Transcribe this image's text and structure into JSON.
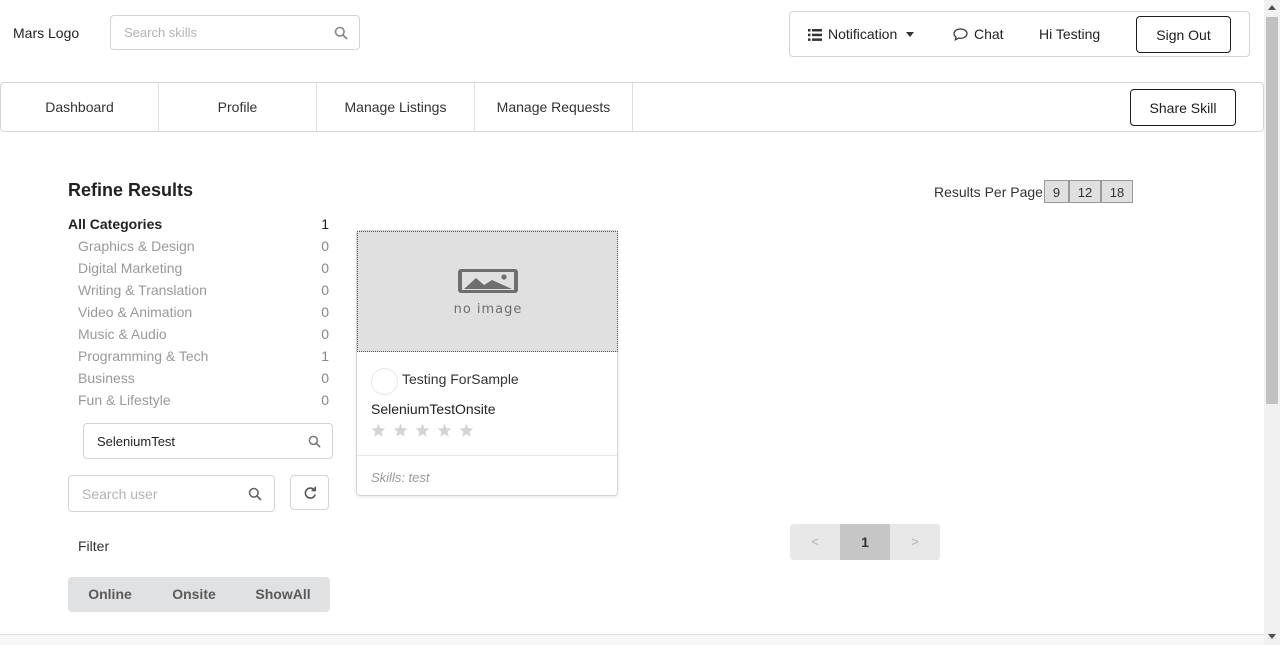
{
  "header": {
    "logo": "Mars Logo",
    "search": {
      "placeholder": "Search skills",
      "value": ""
    },
    "notification_label": "Notification",
    "chat_label": "Chat",
    "greeting": "Hi Testing",
    "signout_label": "Sign Out"
  },
  "nav": {
    "items": [
      {
        "label": "Dashboard"
      },
      {
        "label": "Profile"
      },
      {
        "label": "Manage Listings"
      },
      {
        "label": "Manage Requests"
      }
    ],
    "share_skill_label": "Share Skill"
  },
  "refine": {
    "title": "Refine Results",
    "categories": [
      {
        "name": "All Categories",
        "count": "1"
      },
      {
        "name": "Graphics & Design",
        "count": "0"
      },
      {
        "name": "Digital Marketing",
        "count": "0"
      },
      {
        "name": "Writing & Translation",
        "count": "0"
      },
      {
        "name": "Video & Animation",
        "count": "0"
      },
      {
        "name": "Music & Audio",
        "count": "0"
      },
      {
        "name": "Programming & Tech",
        "count": "1"
      },
      {
        "name": "Business",
        "count": "0"
      },
      {
        "name": "Fun & Lifestyle",
        "count": "0"
      }
    ],
    "subcategory_search_value": "SeleniumTest",
    "user_search": {
      "placeholder": "Search user",
      "value": ""
    },
    "filter_label": "Filter",
    "filters": [
      "Online",
      "Onsite",
      "ShowAll"
    ]
  },
  "results": {
    "per_page_label": "Results Per Page :",
    "per_page_options": [
      "9",
      "12",
      "18"
    ]
  },
  "card": {
    "image_text": "no image",
    "user_name": "Testing ForSample",
    "title": "SeleniumTestOnsite",
    "rating": 0,
    "rating_max": 5,
    "skills": "Skills: test"
  },
  "pagination": {
    "prev": "<",
    "current": "1",
    "next": ">"
  },
  "colors": {
    "star_empty": "#d4d4d4",
    "filter_bg": "#e0e1e2",
    "image_bg": "#e0e0e0"
  }
}
